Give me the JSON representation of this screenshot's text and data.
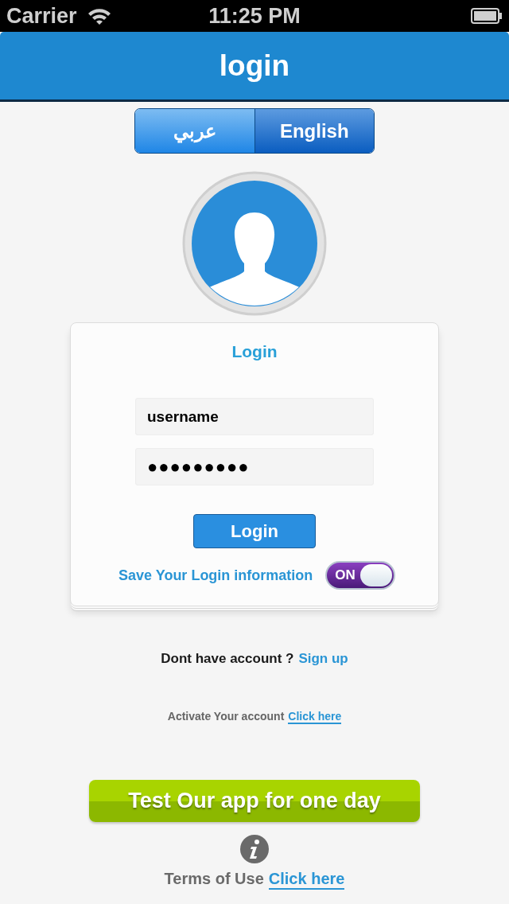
{
  "status_bar": {
    "carrier": "Carrier",
    "time": "11:25 PM"
  },
  "nav_bar": {
    "title": "login"
  },
  "language_tabs": [
    {
      "label": "عربي",
      "selected": false
    },
    {
      "label": "English",
      "selected": true
    }
  ],
  "login_card": {
    "title": "Login",
    "username": {
      "value": "username"
    },
    "password": {
      "value": "●●●●●●●●●"
    },
    "login_button": "Login",
    "remember": {
      "label": "Save Your Login information",
      "toggle_label": "ON",
      "on": true
    }
  },
  "signup": {
    "text": "Dont have account ?",
    "link": "Sign up"
  },
  "activate": {
    "text": "Activate Your account",
    "link": "Click here"
  },
  "trial_button": "Test Our app for one day",
  "terms": {
    "text": "Terms of Use",
    "link": "Click here"
  }
}
